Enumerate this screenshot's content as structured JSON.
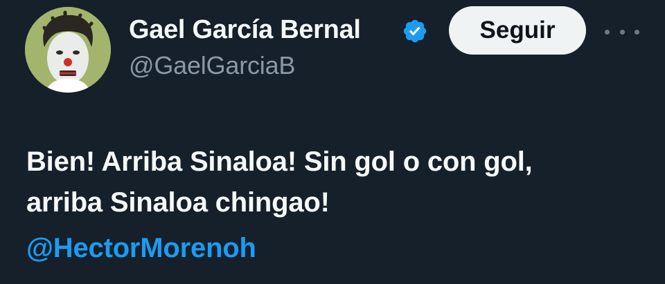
{
  "author": {
    "display_name": "Gael García Bernal",
    "handle": "@GaelGarciaB",
    "verified_icon": "verified-badge-icon",
    "avatar_icon": "profile-avatar"
  },
  "follow_button": {
    "label": "Seguir"
  },
  "more_menu": {
    "icon": "more-options-icon"
  },
  "tweet": {
    "lines": [
      "Bien! Arriba Sinaloa! Sin gol o con gol,",
      "arriba Sinaloa chingao!"
    ],
    "mention": "@HectorMorenoh"
  },
  "colors": {
    "background": "#15202b",
    "primary_text": "#f7f9f9",
    "secondary_text": "#8b98a5",
    "accent": "#1d9bf0",
    "button_bg": "#eff3f4"
  }
}
